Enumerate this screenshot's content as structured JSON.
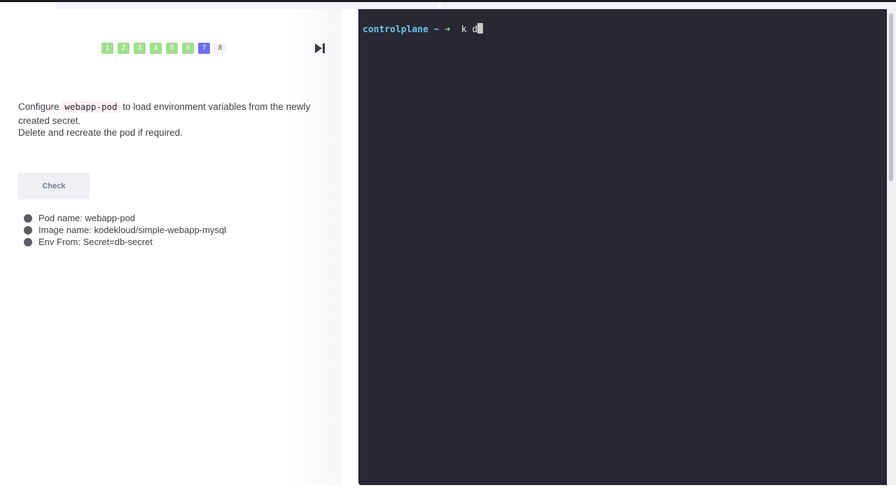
{
  "steps": {
    "items": [
      "1",
      "2",
      "3",
      "4",
      "5",
      "6",
      "7",
      "8"
    ],
    "current": "7"
  },
  "question": {
    "prefix": "Configure ",
    "code": "webapp-pod",
    "suffix": " to load environment variables from the newly created secret.",
    "line2": "Delete and recreate the pod if required."
  },
  "check_button": {
    "label": "Check"
  },
  "hints": [
    "Pod name: webapp-pod",
    "Image name: kodekloud/simple-webapp-mysql",
    "Env From: Secret=db-secret"
  ],
  "terminal": {
    "host": "controlplane",
    "tilde": "~",
    "arrow": "➜",
    "command": "k d"
  },
  "icons": {
    "skip": "skip-to-end-icon"
  },
  "colors": {
    "step_done": "#9ee08c",
    "step_current": "#6d6ef0",
    "terminal_bg": "#282834",
    "prompt_host": "#6ac2e8",
    "prompt_arrow": "#7ee58a"
  }
}
